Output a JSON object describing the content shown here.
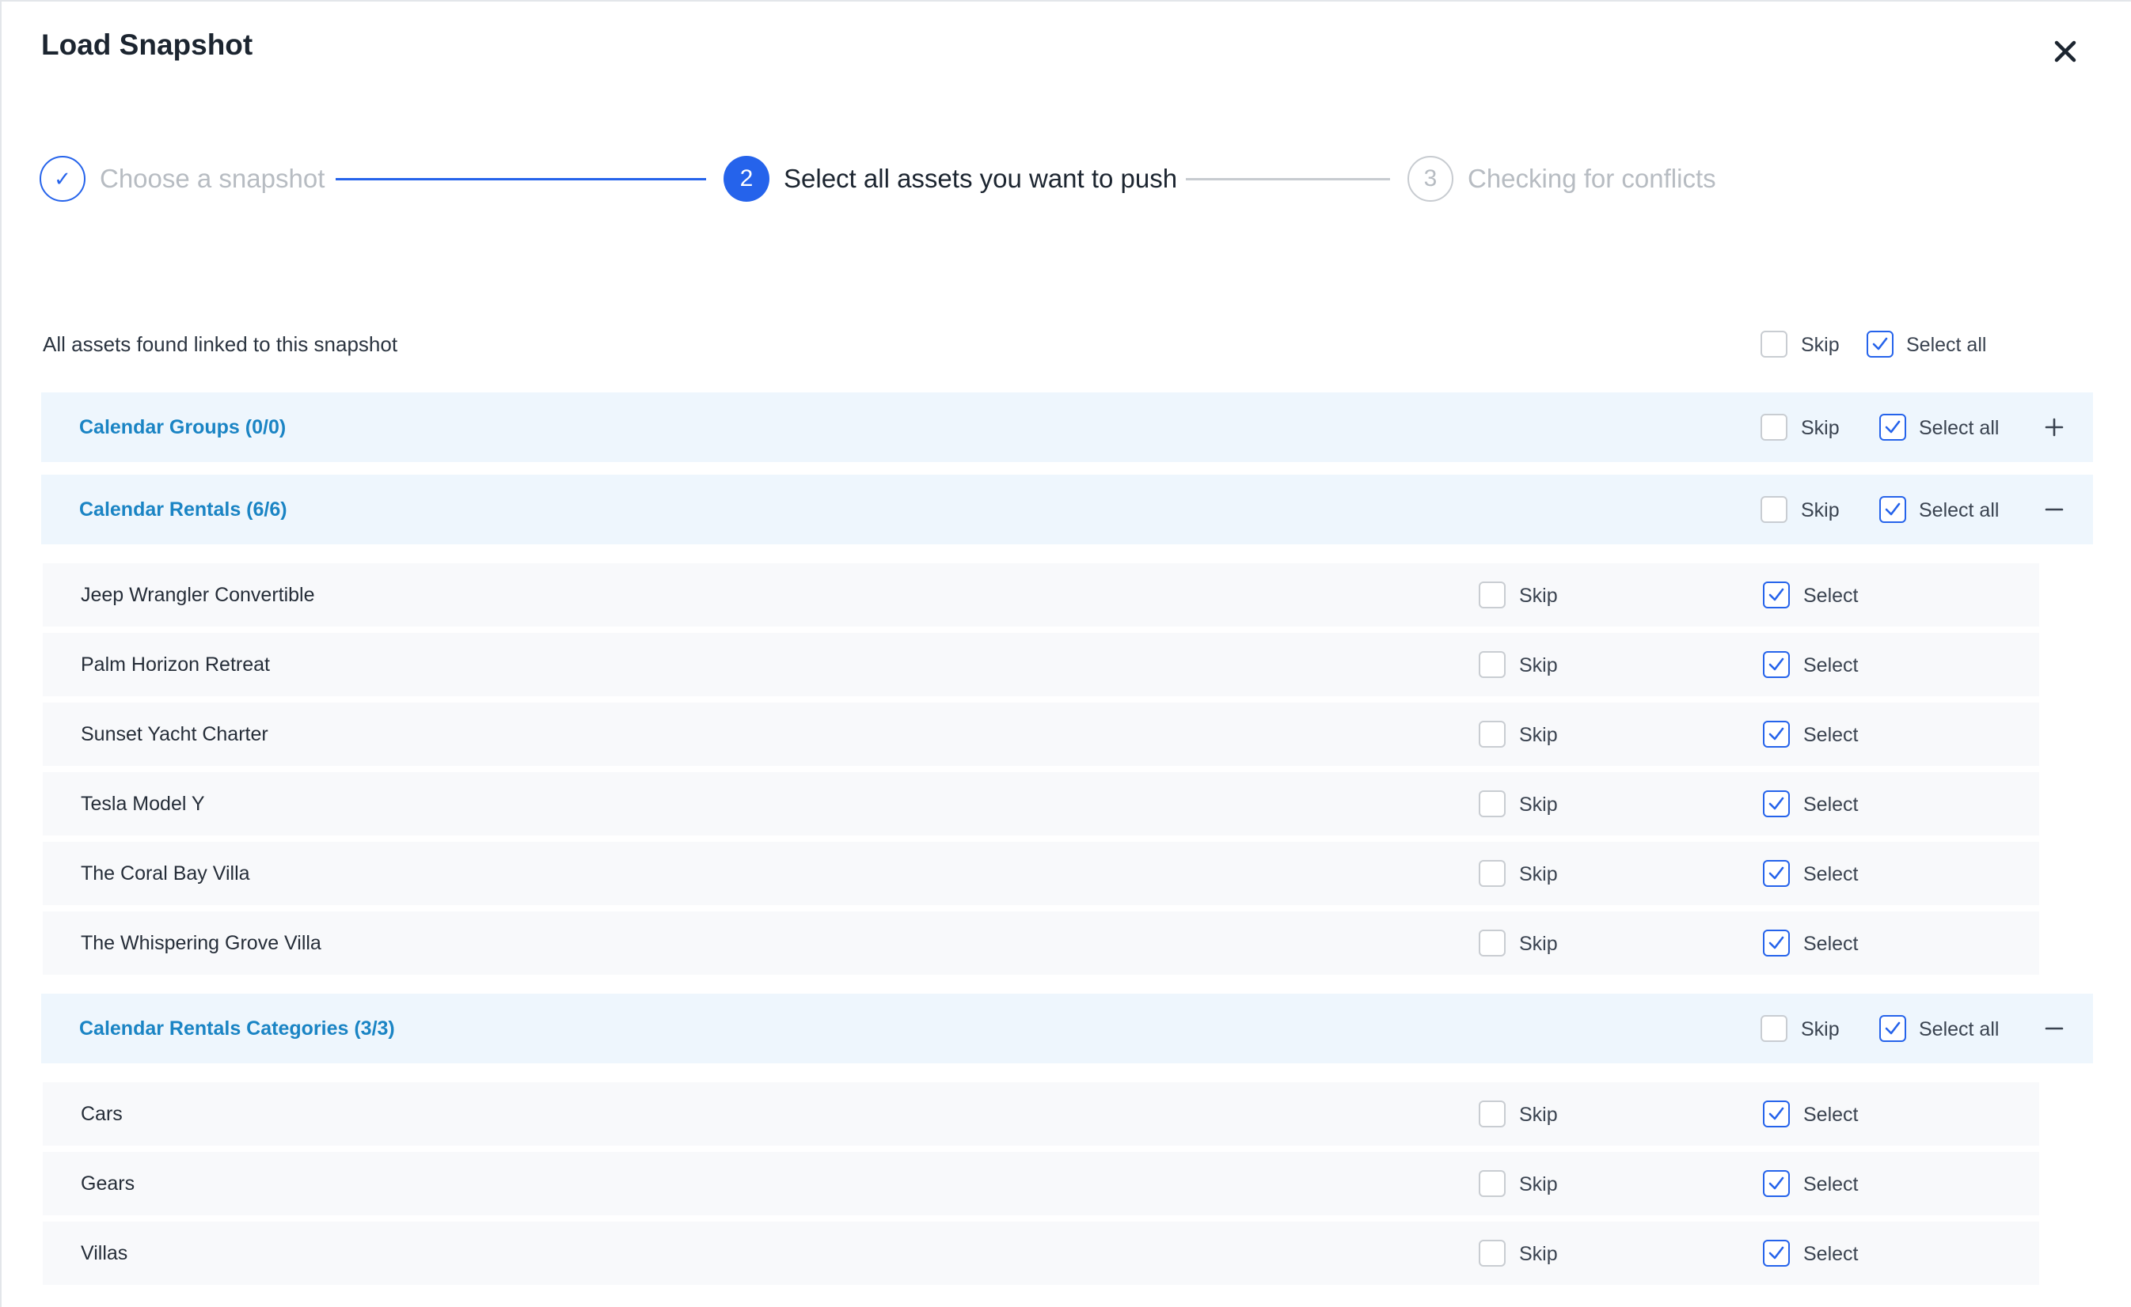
{
  "modal": {
    "title": "Load Snapshot"
  },
  "stepper": {
    "steps": [
      {
        "number": "✓",
        "label": "Choose a snapshot",
        "state": "done"
      },
      {
        "number": "2",
        "label": "Select all assets you want to push",
        "state": "active"
      },
      {
        "number": "3",
        "label": "Checking for conflicts",
        "state": "pending"
      }
    ]
  },
  "colors": {
    "accent": "#2563eb",
    "group_title": "#1a84c4",
    "group_bg": "#eef6fd",
    "row_bg": "#f8f9fb"
  },
  "header": {
    "label": "All assets found linked to this snapshot",
    "skip_label": "Skip",
    "select_all_label": "Select all"
  },
  "groups": [
    {
      "title": "Calendar Groups (0/0)",
      "skip_label": "Skip",
      "select_all_label": "Select all",
      "toggle_icon": "plus-icon",
      "items": []
    },
    {
      "title": "Calendar Rentals (6/6)",
      "skip_label": "Skip",
      "select_all_label": "Select all",
      "toggle_icon": "minus-icon",
      "items": [
        {
          "name": "Jeep Wrangler Convertible",
          "skip_label": "Skip",
          "select_label": "Select"
        },
        {
          "name": "Palm Horizon Retreat",
          "skip_label": "Skip",
          "select_label": "Select"
        },
        {
          "name": "Sunset Yacht Charter",
          "skip_label": "Skip",
          "select_label": "Select"
        },
        {
          "name": "Tesla Model Y",
          "skip_label": "Skip",
          "select_label": "Select"
        },
        {
          "name": "The Coral Bay Villa",
          "skip_label": "Skip",
          "select_label": "Select"
        },
        {
          "name": "The Whispering Grove Villa",
          "skip_label": "Skip",
          "select_label": "Select"
        }
      ]
    },
    {
      "title": "Calendar Rentals Categories (3/3)",
      "skip_label": "Skip",
      "select_all_label": "Select all",
      "toggle_icon": "minus-icon",
      "items": [
        {
          "name": "Cars",
          "skip_label": "Skip",
          "select_label": "Select"
        },
        {
          "name": "Gears",
          "skip_label": "Skip",
          "select_label": "Select"
        },
        {
          "name": "Villas",
          "skip_label": "Skip",
          "select_label": "Select"
        }
      ]
    }
  ]
}
